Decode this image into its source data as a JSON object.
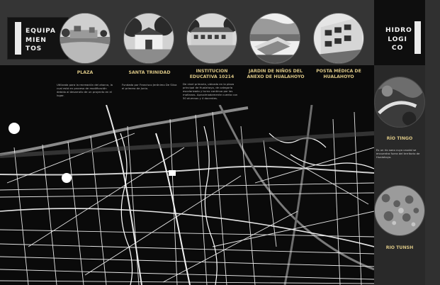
{
  "left_block": {
    "title_line1": "EQUIPA",
    "title_line2": "MIEN",
    "title_line3": "TOS"
  },
  "right_block": {
    "title_line1": "HIDRO",
    "title_line2": "LOGI",
    "title_line3": "CO"
  },
  "places": [
    {
      "title": "PLAZA",
      "desc": "Utilizada para la recreación del ahorco, la cual está en proceso de modificación debido al desarrollo de un proyecto en el lugar."
    },
    {
      "title": "SANTA TRINIDAD",
      "desc": "Fundada por Francisco Jerónimo De Silva el primero de Junio."
    },
    {
      "title": "INSTITUCION EDUCATIVA 10214",
      "desc": "De nivel primaria, ubicado en la plaza principal de Hualahoyo, de categoría escolarizado y turno continuo por las mañanas. Aproximadamente cuenta con 50 alumnos y 4 docentes."
    },
    {
      "title": "JARDIN DE NIÑOS DEL ANEXO DE HUALAHOYO",
      "desc": ""
    },
    {
      "title": "POSTA MÉDICA DE HUALAHOYO",
      "desc": ""
    }
  ],
  "rivers": [
    {
      "title": "RÍO TINGO",
      "desc": "Es un río sano cuyo caudal se encuentra fuera del territorio de Hualahoyo."
    },
    {
      "title": "RIO TUNSH",
      "desc": ""
    }
  ],
  "colors": {
    "accent": "#d8c484",
    "band": "#353535",
    "map_bg": "#0a0a0a"
  }
}
